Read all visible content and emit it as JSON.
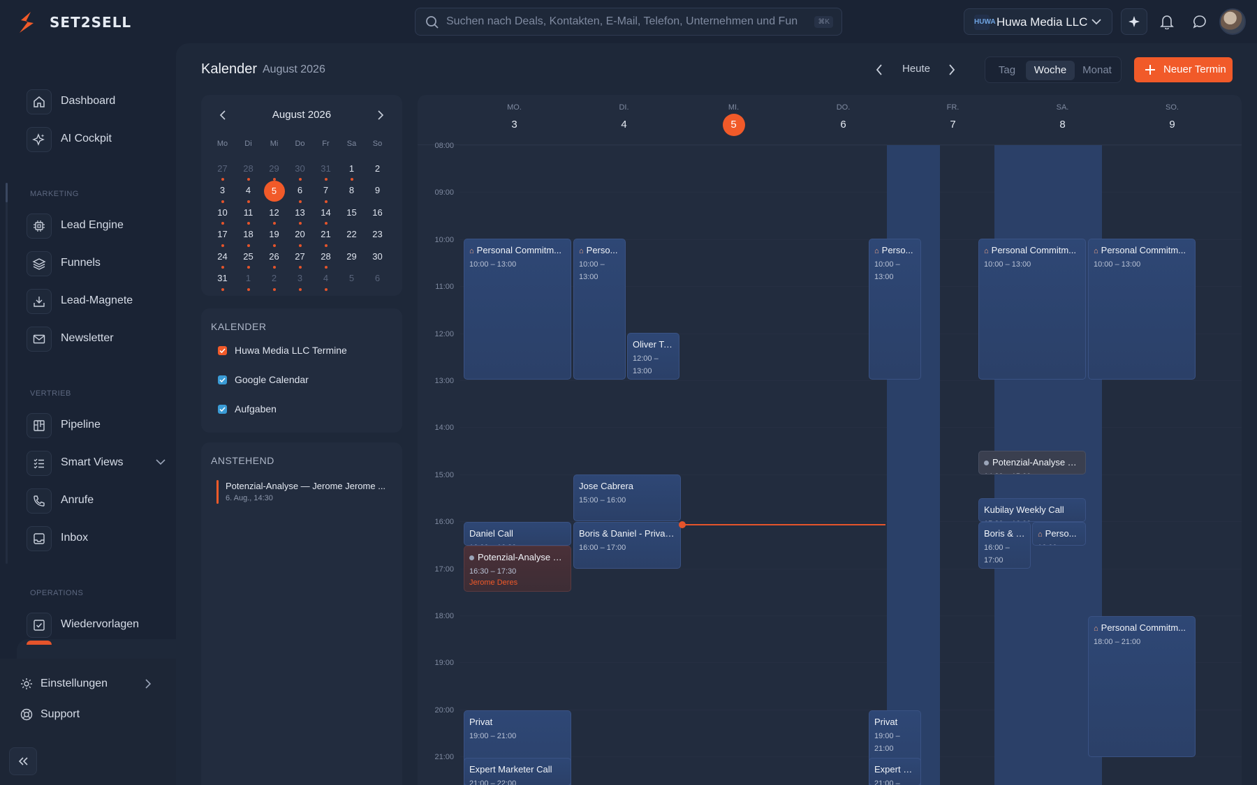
{
  "app": {
    "brand": "SET2SELL"
  },
  "search": {
    "placeholder": "Suchen nach Deals, Kontakten, E-Mail, Telefon, Unternehmen und Fun",
    "shortcut": "⌘K"
  },
  "org": {
    "name": "Huwa Media LLC",
    "logo_text": "HUWA"
  },
  "sidebar": {
    "main": [
      {
        "label": "Dashboard",
        "icon": "home-icon"
      },
      {
        "label": "AI Cockpit",
        "icon": "sparkle-icon"
      }
    ],
    "sections": {
      "marketing": "MARKETING",
      "vertrieb": "VERTRIEB",
      "operations": "OPERATIONS"
    },
    "marketing": [
      {
        "label": "Lead Engine"
      },
      {
        "label": "Funnels"
      },
      {
        "label": "Lead-Magnete"
      },
      {
        "label": "Newsletter"
      }
    ],
    "vertrieb": [
      {
        "label": "Pipeline"
      },
      {
        "label": "Smart Views"
      },
      {
        "label": "Anrufe"
      },
      {
        "label": "Inbox"
      }
    ],
    "operations": [
      {
        "label": "Wiedervorlagen"
      }
    ],
    "bottom": [
      {
        "label": "Einstellungen"
      },
      {
        "label": "Support"
      }
    ]
  },
  "header": {
    "title": "Kalender",
    "subtitle": "August 2026",
    "today": "Heute",
    "views": [
      "Tag",
      "Woche",
      "Monat"
    ],
    "active_view": "Woche",
    "new_button": "Neuer Termin"
  },
  "mini_calendar": {
    "month": "August 2026",
    "weekdays": [
      "Mo",
      "Di",
      "Mi",
      "Do",
      "Fr",
      "Sa",
      "So"
    ],
    "days": [
      {
        "n": "27",
        "m": true,
        "e": true
      },
      {
        "n": "28",
        "m": true,
        "e": true
      },
      {
        "n": "29",
        "m": true,
        "e": true
      },
      {
        "n": "30",
        "m": true,
        "e": true
      },
      {
        "n": "31",
        "m": true,
        "e": true
      },
      {
        "n": "1",
        "e": true
      },
      {
        "n": "2"
      },
      {
        "n": "3",
        "e": true
      },
      {
        "n": "4",
        "e": true
      },
      {
        "n": "5",
        "t": true,
        "e": true
      },
      {
        "n": "6",
        "e": true
      },
      {
        "n": "7",
        "e": true
      },
      {
        "n": "8"
      },
      {
        "n": "9"
      },
      {
        "n": "10",
        "e": true
      },
      {
        "n": "11",
        "e": true
      },
      {
        "n": "12",
        "e": true
      },
      {
        "n": "13",
        "e": true
      },
      {
        "n": "14",
        "e": true
      },
      {
        "n": "15"
      },
      {
        "n": "16"
      },
      {
        "n": "17",
        "e": true
      },
      {
        "n": "18",
        "e": true
      },
      {
        "n": "19",
        "e": true
      },
      {
        "n": "20",
        "e": true
      },
      {
        "n": "21",
        "e": true
      },
      {
        "n": "22"
      },
      {
        "n": "23"
      },
      {
        "n": "24",
        "e": true
      },
      {
        "n": "25",
        "e": true
      },
      {
        "n": "26",
        "e": true
      },
      {
        "n": "27",
        "e": true
      },
      {
        "n": "28",
        "e": true
      },
      {
        "n": "29"
      },
      {
        "n": "30"
      },
      {
        "n": "31",
        "e": true
      },
      {
        "n": "1",
        "m": true,
        "e": true
      },
      {
        "n": "2",
        "m": true,
        "e": true
      },
      {
        "n": "3",
        "m": true,
        "e": true
      },
      {
        "n": "4",
        "m": true,
        "e": true
      },
      {
        "n": "5",
        "m": true
      },
      {
        "n": "6",
        "m": true
      }
    ]
  },
  "calendars": {
    "title": "KALENDER",
    "items": [
      {
        "label": "Huwa Media LLC Termine",
        "color": "#f15a29"
      },
      {
        "label": "Google Calendar",
        "color": "#3a9bd5"
      },
      {
        "label": "Aufgaben",
        "color": "#3a9bd5"
      }
    ]
  },
  "upcoming": {
    "title": "ANSTEHEND",
    "items": [
      {
        "title": "Potenzial-Analyse — Jerome Jerome ...",
        "date": "6. Aug., 14:30"
      }
    ]
  },
  "week": {
    "days": [
      {
        "wd": "MO.",
        "n": "3"
      },
      {
        "wd": "DI.",
        "n": "4"
      },
      {
        "wd": "MI.",
        "n": "5",
        "today": true
      },
      {
        "wd": "DO.",
        "n": "6"
      },
      {
        "wd": "FR.",
        "n": "7"
      },
      {
        "wd": "SA.",
        "n": "8"
      },
      {
        "wd": "SO.",
        "n": "9"
      }
    ],
    "hours": [
      "08:00",
      "09:00",
      "10:00",
      "11:00",
      "12:00",
      "13:00",
      "14:00",
      "15:00",
      "16:00",
      "17:00",
      "18:00",
      "19:00",
      "20:00",
      "21:00"
    ]
  },
  "events": [
    {
      "title": "Personal Commitm...",
      "time": "10:00 – 13:00",
      "house": true
    },
    {
      "title": "Perso...",
      "time": "10:00 – 13:00",
      "house": true
    },
    {
      "title": "Oliver Te...",
      "time": "12:00 – 13:00"
    },
    {
      "title": "Perso...",
      "time": "10:00 – 13:00",
      "house": true
    },
    {
      "title": "Personal Commitm...",
      "time": "10:00 – 13:00",
      "house": true
    },
    {
      "title": "Personal Commitm...",
      "time": "10:00 – 13:00",
      "house": true
    },
    {
      "title": "Potenzial-Analyse —...",
      "time": "14:30 – 15:00",
      "dot": true
    },
    {
      "title": "Jose Cabrera",
      "time": "15:00 – 16:00"
    },
    {
      "title": "Kubilay Weekly Call",
      "time": "15:30 – 16:00"
    },
    {
      "title": "Daniel Call",
      "time": "16:00 – 16:30"
    },
    {
      "title": "Boris & Daniel - Private...",
      "time": "16:00 – 17:00"
    },
    {
      "title": "Boris & D...",
      "time": "16:00 – 17:00"
    },
    {
      "title": "Perso...",
      "time": "16:00",
      "house": true
    },
    {
      "title": "Potenzial-Analyse —...",
      "time": "16:30 – 17:30",
      "person": "Jerome Deres",
      "dot": true
    },
    {
      "title": "Personal Commitm...",
      "time": "18:00 – 21:00",
      "house": true
    },
    {
      "title": "Privat",
      "time": "19:00 – 21:00"
    },
    {
      "title": "Privat",
      "time": "19:00 – 21:00"
    },
    {
      "title": "Expert Marketer Call",
      "time": "21:00 – 22:00"
    },
    {
      "title": "Expert M...",
      "time": "21:00 –"
    }
  ]
}
